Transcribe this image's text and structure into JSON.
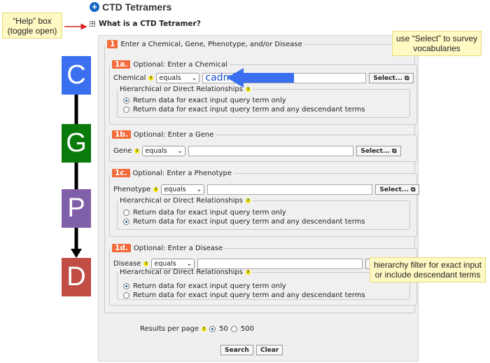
{
  "header": {
    "title": "CTD Tetramers",
    "help_toggle": "What is a CTD Tetramer?"
  },
  "annotations": {
    "help_box": "“Help” box\n(toggle open)",
    "select_note": "use “Select” to survey vocabularies",
    "hierarchy_note": "hierarchy filter for exact input or include descendant terms"
  },
  "cgpd": [
    {
      "letter": "C",
      "color": "#3a6ff0"
    },
    {
      "letter": "G",
      "color": "#0a7a0a"
    },
    {
      "letter": "P",
      "color": "#7f5fa8"
    },
    {
      "letter": "D",
      "color": "#c24d45"
    }
  ],
  "step1": {
    "badge": "1",
    "label": "Enter a Chemical, Gene, Phenotype, and/or Disease"
  },
  "chemical": {
    "badge": "1a.",
    "label": "Optional: Enter a Chemical",
    "field_label": "Chemical",
    "operator": "equals",
    "value": "cadmium",
    "select": "Select...",
    "hier_label": "Hierarchical or Direct Relationships",
    "opt1": "Return data for exact input query term only",
    "opt2": "Return data for exact input query term and any descendant terms",
    "selected": 1
  },
  "gene": {
    "badge": "1b.",
    "label": "Optional: Enter a Gene",
    "field_label": "Gene",
    "operator": "equals",
    "value": "",
    "select": "Select..."
  },
  "phenotype": {
    "badge": "1c.",
    "label": "Optional: Enter a Phenotype",
    "field_label": "Phenotype",
    "operator": "equals",
    "value": "",
    "select": "Select...",
    "hier_label": "Hierarchical or Direct Relationships",
    "opt1": "Return data for exact input query term only",
    "opt2": "Return data for exact input query term and any descendant terms",
    "selected": 2
  },
  "disease": {
    "badge": "1d.",
    "label": "Optional: Enter a Disease",
    "field_label": "Disease",
    "operator": "equals",
    "value": "",
    "select": "Se",
    "hier_label": "Hierarchical or Direct Relationships",
    "opt1": "Return data for exact input query term only",
    "opt2": "Return data for exact input query term and any descendant terms",
    "selected": 1
  },
  "results": {
    "label": "Results per page",
    "opt1": "50",
    "opt2": "500",
    "selected": "50"
  },
  "buttons": {
    "search": "Search",
    "clear": "Clear"
  }
}
